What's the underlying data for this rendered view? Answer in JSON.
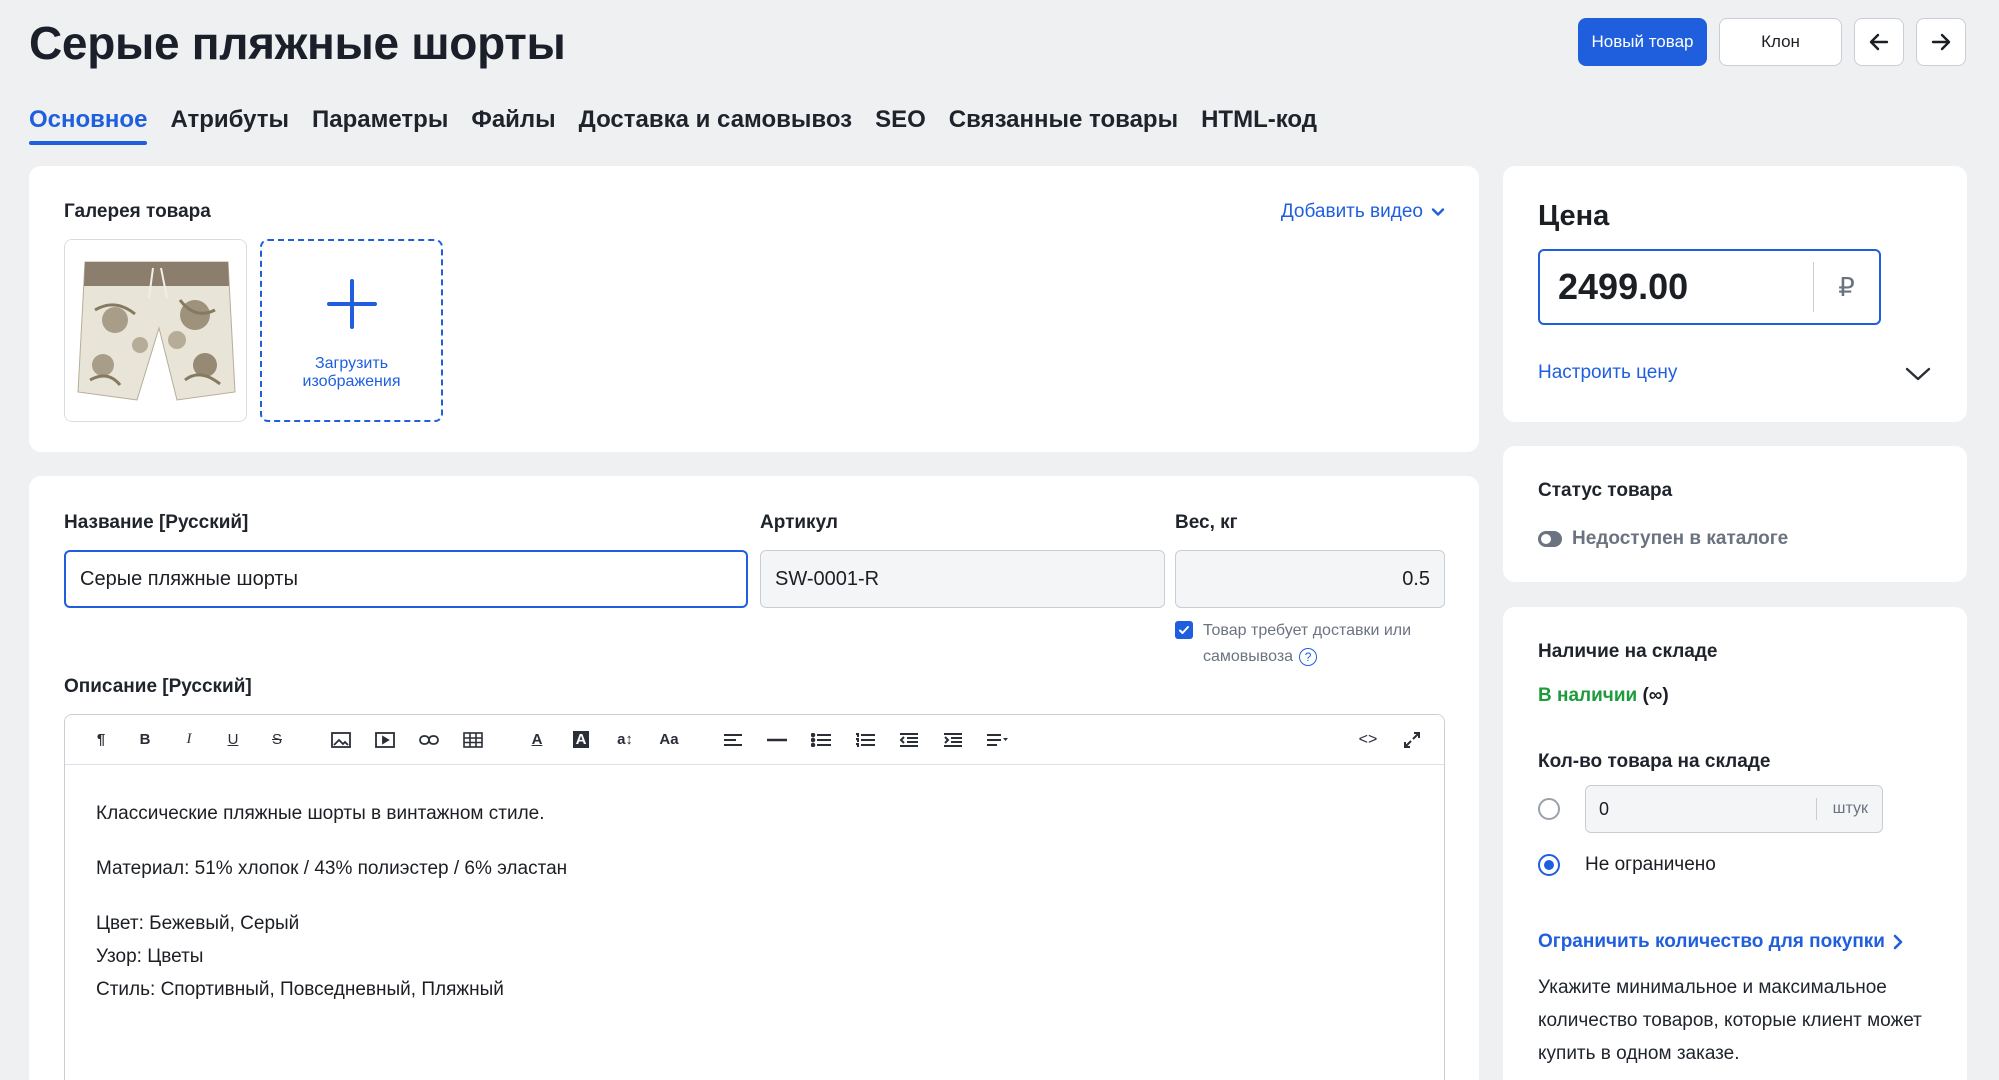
{
  "page": {
    "title": "Серые пляжные шорты"
  },
  "actions": {
    "new_product": "Новый товар",
    "clone": "Клон",
    "prev_icon": "arrow-left-icon",
    "next_icon": "arrow-right-icon"
  },
  "tabs": [
    {
      "label": "Основное",
      "active": true
    },
    {
      "label": "Атрибуты"
    },
    {
      "label": "Параметры"
    },
    {
      "label": "Файлы"
    },
    {
      "label": "Доставка и самовывоз"
    },
    {
      "label": "SEO"
    },
    {
      "label": "Связанные товары"
    },
    {
      "label": "HTML-код"
    }
  ],
  "gallery": {
    "title": "Галерея товара",
    "add_video": "Добавить видео",
    "upload_label": "Загрузить изображения"
  },
  "product": {
    "name_label": "Название [Русский]",
    "name_value": "Серые пляжные шорты",
    "sku_label": "Артикул",
    "sku_value": "SW-0001-R",
    "weight_label": "Вес, кг",
    "weight_value": "0.5",
    "delivery_required": "Товар требует доставки или самовывоза",
    "description_label": "Описание [Русский]",
    "description": {
      "p1": "Классические пляжные шорты в винтажном стиле.",
      "p2": "Материал: 51% хлопок / 43% полиэстер / 6% эластан",
      "color": "Цвет: Бежевый, Серый",
      "pattern": "Узор: Цветы",
      "style": "Стиль: Спортивный, Повседневный, Пляжный"
    }
  },
  "price": {
    "title": "Цена",
    "value": "2499.00",
    "currency": "₽",
    "configure": "Настроить цену"
  },
  "status": {
    "title": "Статус товара",
    "value": "Недоступен в каталоге"
  },
  "stock": {
    "title": "Наличие на складе",
    "status": "В наличии",
    "status_suffix": "(∞)",
    "qty_title": "Кол-во товара на складе",
    "qty_value": "0",
    "qty_unit": "штук",
    "unlimited": "Не ограничено",
    "unlimited_selected": true,
    "limit_link": "Ограничить количество для покупки",
    "limit_note": "Укажите минимальное и максимальное количество товаров, которые клиент может купить в одном заказе."
  },
  "colors": {
    "accent": "#1f5fde",
    "success": "#1e9b3b",
    "background": "#eef0f2"
  }
}
